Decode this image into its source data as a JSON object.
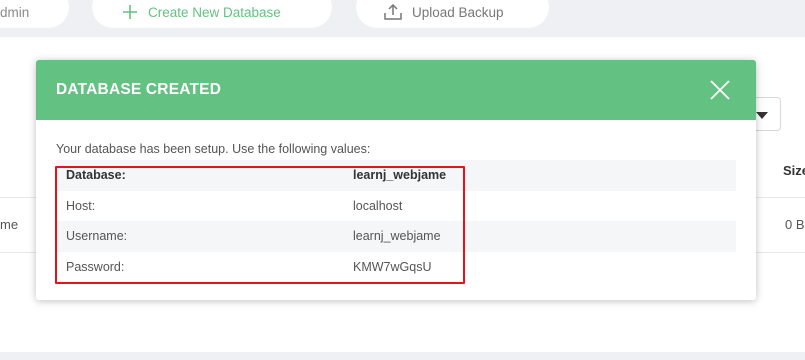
{
  "toolbar": {
    "admin_label": "dmin",
    "create_label": "Create New Database",
    "upload_label": "Upload Backup"
  },
  "background_table": {
    "size_header": "Size",
    "row_name": "me",
    "row_size": "0 B"
  },
  "modal": {
    "title": "DATABASE CREATED",
    "intro": "Your database has been setup. Use the following values:",
    "rows": [
      {
        "key": "Database:",
        "value": "learnj_webjame"
      },
      {
        "key": "Host:",
        "value": "localhost"
      },
      {
        "key": "Username:",
        "value": "learnj_webjame"
      },
      {
        "key": "Password:",
        "value": "KMW7wGqsU"
      }
    ]
  },
  "colors": {
    "accent": "#63c181",
    "highlight": "#e3121b"
  },
  "icons": {
    "create": "plus-icon",
    "upload": "upload-icon",
    "close": "close-icon",
    "dropdown": "caret-down-icon"
  }
}
